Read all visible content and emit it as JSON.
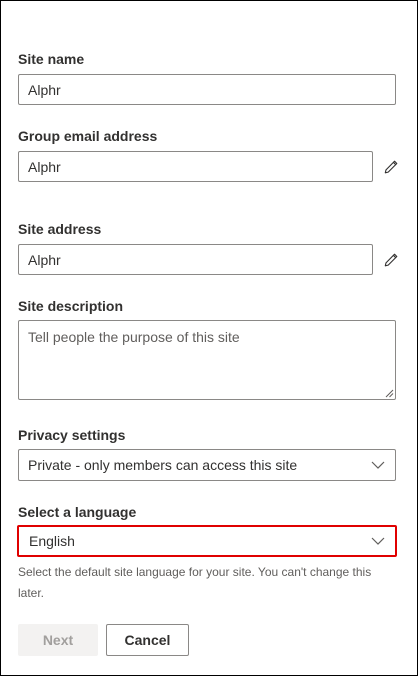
{
  "form": {
    "site_name": {
      "label": "Site name",
      "value": "Alphr"
    },
    "group_email": {
      "label": "Group email address",
      "value": "Alphr"
    },
    "site_address": {
      "label": "Site address",
      "value": "Alphr"
    },
    "site_description": {
      "label": "Site description",
      "placeholder": "Tell people the purpose of this site"
    },
    "privacy": {
      "label": "Privacy settings",
      "selected": "Private - only members can access this site"
    },
    "language": {
      "label": "Select a language",
      "selected": "English",
      "help": "Select the default site language for your site. You can't change this later."
    }
  },
  "buttons": {
    "next": "Next",
    "cancel": "Cancel"
  },
  "colors": {
    "highlight_border": "#e00000",
    "input_border": "#8a8886",
    "disabled_bg": "#f3f2f1"
  },
  "icons": {
    "edit": "pencil-icon",
    "dropdown": "chevron-down-icon",
    "resize": "resize-grip-icon"
  }
}
